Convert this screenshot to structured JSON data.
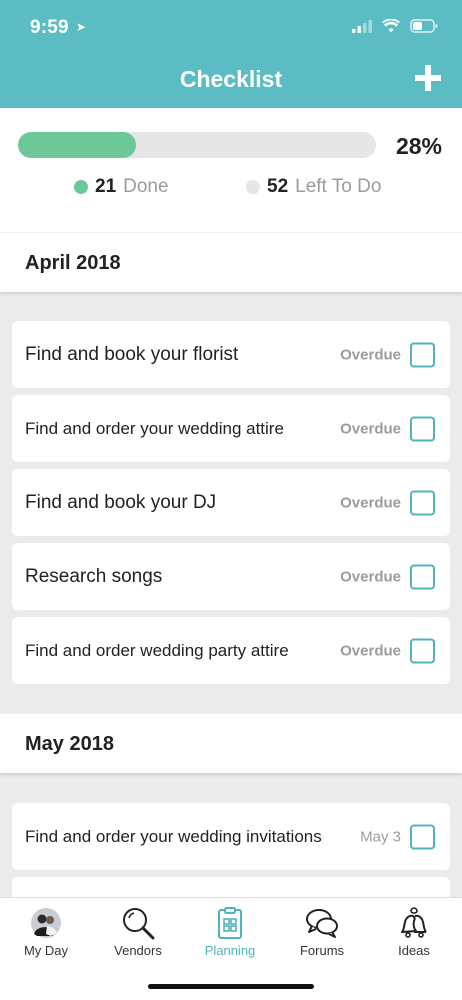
{
  "status_bar": {
    "time": "9:59"
  },
  "header": {
    "title": "Checklist"
  },
  "progress": {
    "percent_label": "28%",
    "fraction": 0.28,
    "done_count": "21",
    "done_label": "Done",
    "todo_count": "52",
    "todo_label": "Left To Do"
  },
  "sections": [
    {
      "title": "April 2018",
      "tasks": [
        {
          "name": "Find and book your florist",
          "status": "Overdue"
        },
        {
          "name": "Find and order your wedding attire",
          "status": "Overdue"
        },
        {
          "name": "Find and book your DJ",
          "status": "Overdue"
        },
        {
          "name": "Research songs",
          "status": "Overdue"
        },
        {
          "name": "Find and order wedding party attire",
          "status": "Overdue"
        }
      ]
    },
    {
      "title": "May 2018",
      "tasks": [
        {
          "name": "Find and order your wedding invitations",
          "status": "May 3"
        }
      ]
    }
  ],
  "tabs": [
    {
      "label": "My Day"
    },
    {
      "label": "Vendors"
    },
    {
      "label": "Planning"
    },
    {
      "label": "Forums"
    },
    {
      "label": "Ideas"
    }
  ],
  "colors": {
    "accent": "#5bbcc3",
    "done": "#6cc898",
    "todo": "#e6e6e6",
    "checkbox": "#4fb3bc"
  }
}
